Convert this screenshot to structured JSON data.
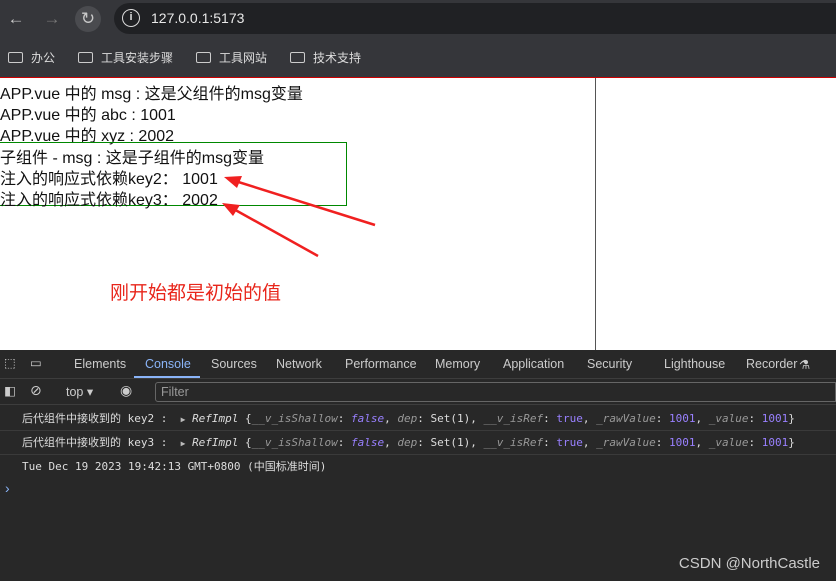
{
  "browser": {
    "url": "127.0.0.1:5173",
    "bookmarks": [
      "办公",
      "工具安装步骤",
      "工具网站",
      "技术支持"
    ]
  },
  "page": {
    "lines": [
      "APP.vue 中的 msg : 这是父组件的msg变量",
      "APP.vue 中的 abc : 1001",
      "APP.vue 中的 xyz : 2002"
    ],
    "child_lines": [
      "子组件 - msg : 这是子组件的msg变量",
      "注入的响应式依赖key2： 1001",
      "注入的响应式依赖key3： 2002"
    ],
    "annotation": "刚开始都是初始的值",
    "annotation_color": "#e8261b"
  },
  "devtools": {
    "tabs": [
      "Elements",
      "Console",
      "Sources",
      "Network",
      "Performance",
      "Memory",
      "Application",
      "Security",
      "Lighthouse",
      "Recorder"
    ],
    "active_tab": "Console",
    "context": "top",
    "filter_placeholder": "Filter",
    "messages": [
      {
        "label": "后代组件中接收到的 key2  :",
        "obj": "RefImpl",
        "isShallow": "false",
        "dep": "Set(1)",
        "isRef": "true",
        "rawValue": "1001",
        "value": "1001"
      },
      {
        "label": "后代组件中接收到的 key3  :",
        "obj": "RefImpl",
        "isShallow": "false",
        "dep": "Set(1)",
        "isRef": "true",
        "rawValue": "1001",
        "value": "1001"
      }
    ],
    "date_line": "Tue Dec 19 2023 19:42:13 GMT+0800 (中国标准时间)",
    "prompt": "›"
  },
  "watermark": "CSDN @NorthCastle"
}
